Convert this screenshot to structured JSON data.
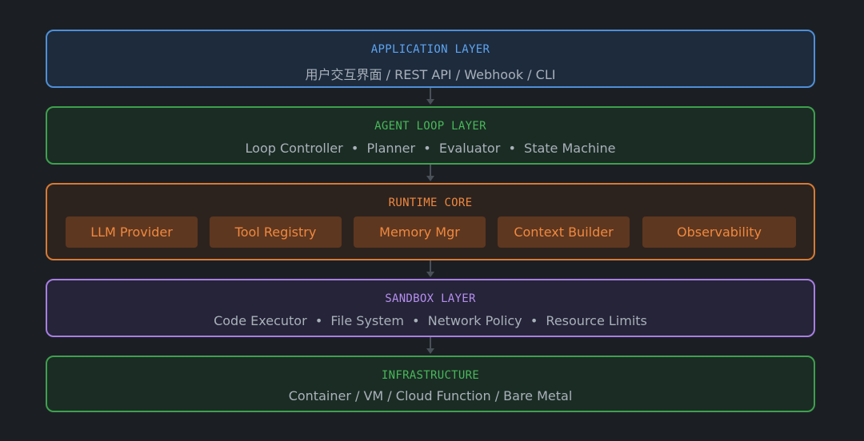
{
  "layers": [
    {
      "title": "APPLICATION LAYER",
      "description": "用户交互界面 / REST API / Webhook / CLI"
    },
    {
      "title": "AGENT LOOP LAYER",
      "description": "Loop Controller  •  Planner  •  Evaluator  •  State Machine"
    },
    {
      "title": "RUNTIME CORE",
      "components": [
        "LLM Provider",
        "Tool Registry",
        "Memory Mgr",
        "Context Builder",
        "Observability"
      ]
    },
    {
      "title": "SANDBOX LAYER",
      "description": "Code Executor  •  File System  •  Network Policy  •  Resource Limits"
    },
    {
      "title": "INFRASTRUCTURE",
      "description": "Container / VM / Cloud Function / Bare Metal"
    }
  ],
  "colors": {
    "background": "#1b1f24",
    "application": "#5ea4f0",
    "agent_loop": "#48b85a",
    "runtime": "#f0883e",
    "sandbox": "#b68ef0",
    "infrastructure": "#48b85a",
    "connector": "#4a5058"
  }
}
